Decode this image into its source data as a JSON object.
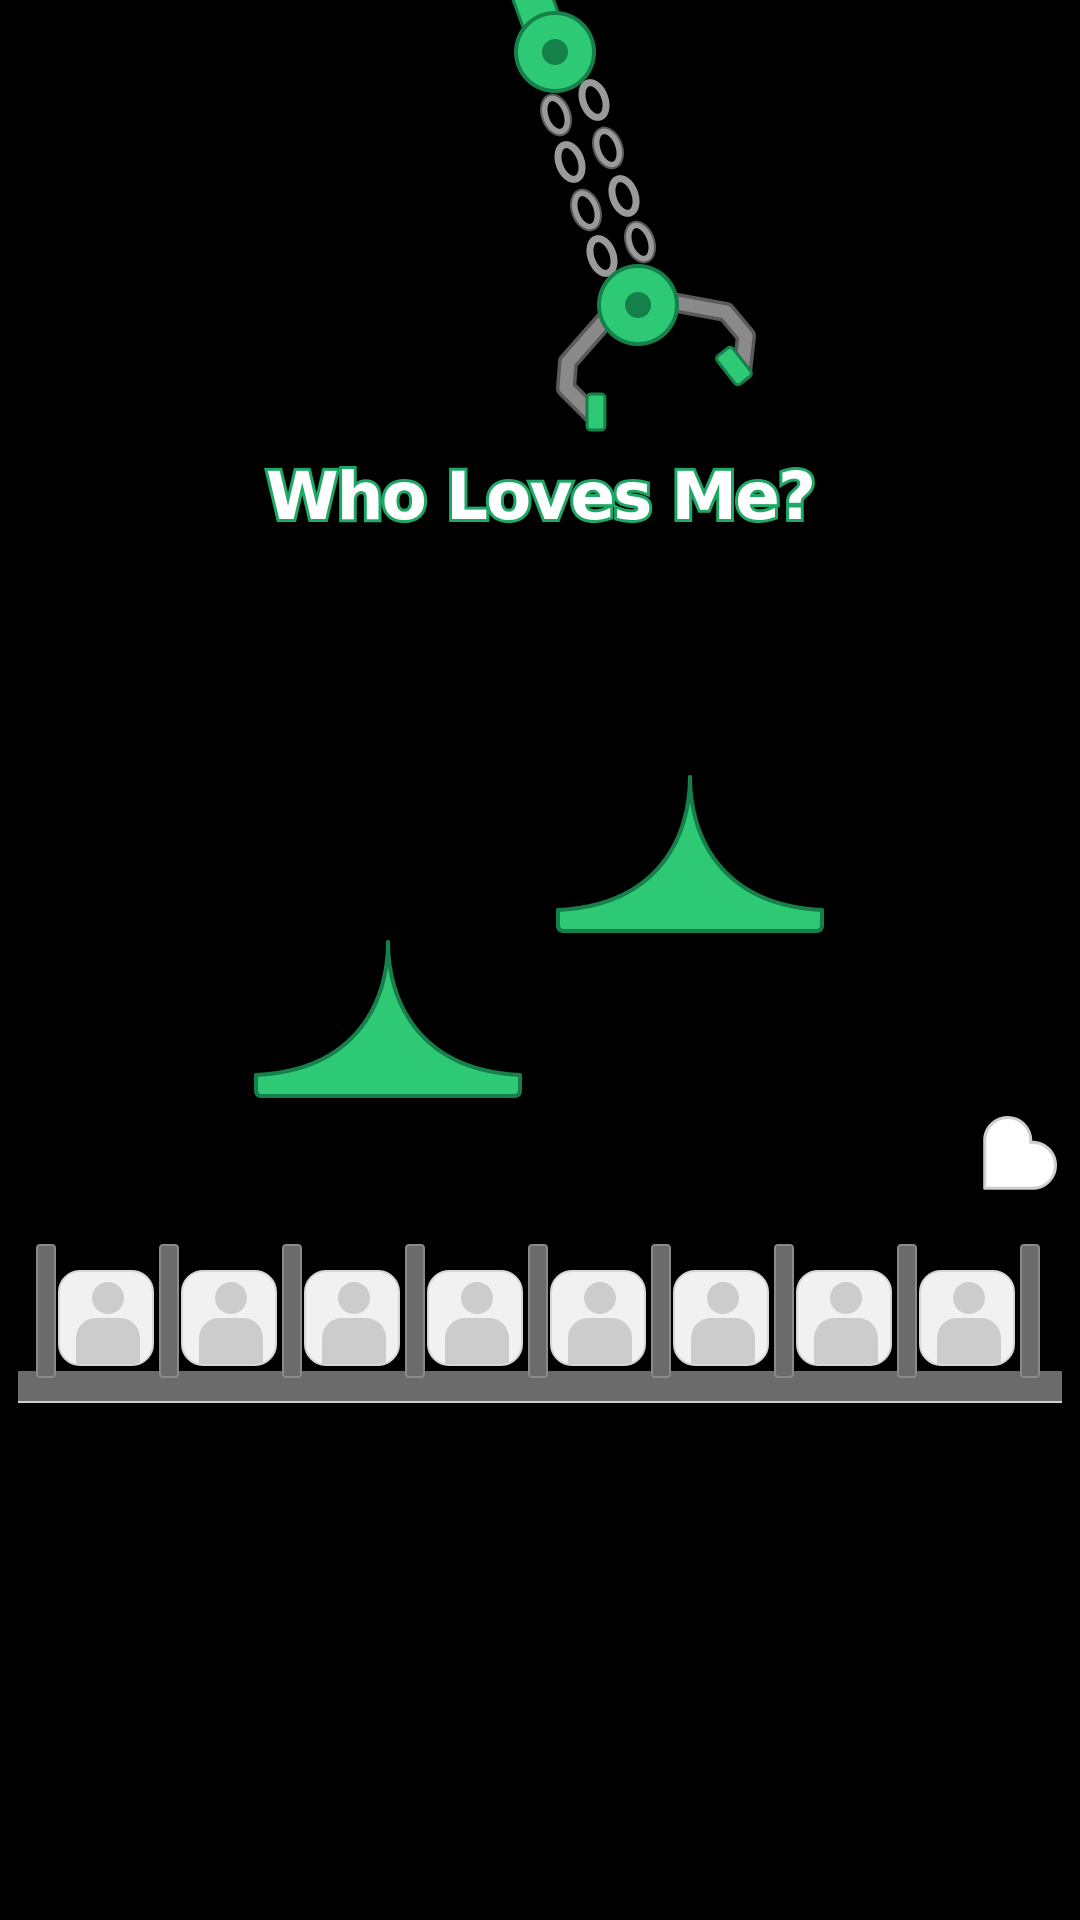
{
  "title": "Who Loves Me?",
  "colors": {
    "background": "#000000",
    "accent_green": "#2ec975",
    "accent_green_dark": "#16804a",
    "metal": "#6b6b6b",
    "chain": "#9a9a9a",
    "slot_fill": "#f1f1f1",
    "avatar_placeholder": "#cccccc",
    "heart": "#ffffff"
  },
  "icons": {
    "crane": "claw-crane-icon",
    "platform": "bell-platform-icon",
    "heart": "heart-icon",
    "avatar": "user-placeholder-icon"
  },
  "slots": [
    {
      "avatar": "user-placeholder-icon"
    },
    {
      "avatar": "user-placeholder-icon"
    },
    {
      "avatar": "user-placeholder-icon"
    },
    {
      "avatar": "user-placeholder-icon"
    },
    {
      "avatar": "user-placeholder-icon"
    },
    {
      "avatar": "user-placeholder-icon"
    },
    {
      "avatar": "user-placeholder-icon"
    },
    {
      "avatar": "user-placeholder-icon"
    }
  ]
}
